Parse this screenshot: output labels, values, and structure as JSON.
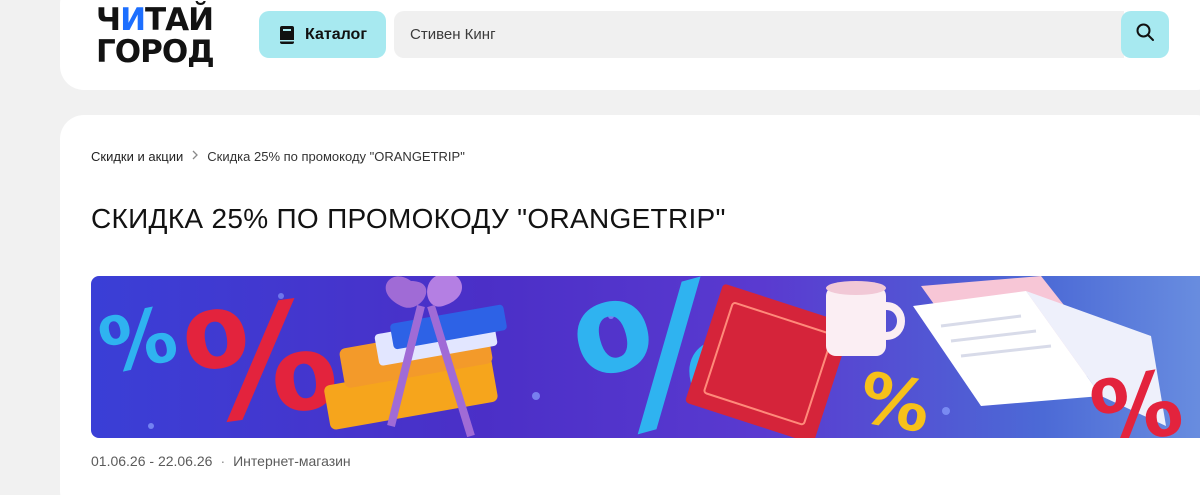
{
  "header": {
    "logo_line1_a": "Ч",
    "logo_line1_b": "И",
    "logo_line1_c": "ТАЙ",
    "logo_line2": "ГОРОД",
    "catalog_label": "Каталог",
    "search_value": "Стивен Кинг",
    "accent_color": "#a7e9f0",
    "logo_accent_color": "#1d6fff"
  },
  "breadcrumb": {
    "items": [
      "Скидки и акции",
      "Скидка 25% по промокоду \"ORANGETRIP\""
    ],
    "separator_icon": "chevron-right-icon"
  },
  "page": {
    "title": "СКИДКА 25% ПО ПРОМОКОДУ \"ORANGETRIP\""
  },
  "banner": {
    "symbols": [
      "%",
      "%",
      "%",
      "%",
      "%"
    ],
    "icons": [
      "percent-icon",
      "books-gift-icon",
      "red-book-icon",
      "coffee-cup-icon",
      "open-book-icon"
    ]
  },
  "meta": {
    "dates": "01.06.26 - 22.06.26",
    "separator": "·",
    "channel": "Интернет-магазин"
  }
}
